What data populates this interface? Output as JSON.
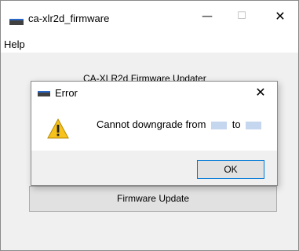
{
  "window": {
    "title": "ca-xlr2d_firmware",
    "minimize": "—",
    "maximize": "☐",
    "close": "✕"
  },
  "menu": {
    "help": "Help"
  },
  "main": {
    "header_label": "CA-XLR2d Firmware Updater",
    "update_button": "Firmware Update"
  },
  "dialog": {
    "title": "Error",
    "close": "✕",
    "message_prefix": "Cannot downgrade from",
    "message_middle": "to",
    "ok_label": "OK",
    "icon": "warning-icon"
  }
}
